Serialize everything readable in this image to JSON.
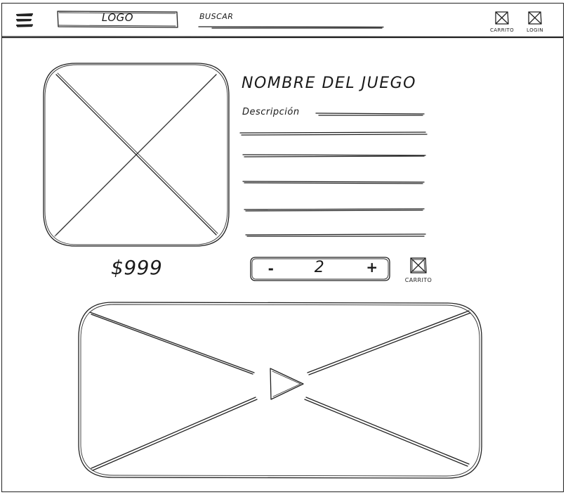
{
  "header": {
    "logo_text": "LOGO",
    "search_placeholder": "BUSCAR",
    "cart_label": "CARRITO",
    "login_label": "LOGIN"
  },
  "product": {
    "title": "NOMBRE DEL JUEGO",
    "description_label": "Descripción",
    "price": "$999",
    "quantity": {
      "decrement_label": "-",
      "value": "2",
      "increment_label": "+"
    },
    "add_to_cart_label": "CARRITO"
  },
  "icons": {
    "menu": "hamburger-menu-icon",
    "cart": "cart-icon",
    "login": "login-icon",
    "play": "play-icon"
  }
}
